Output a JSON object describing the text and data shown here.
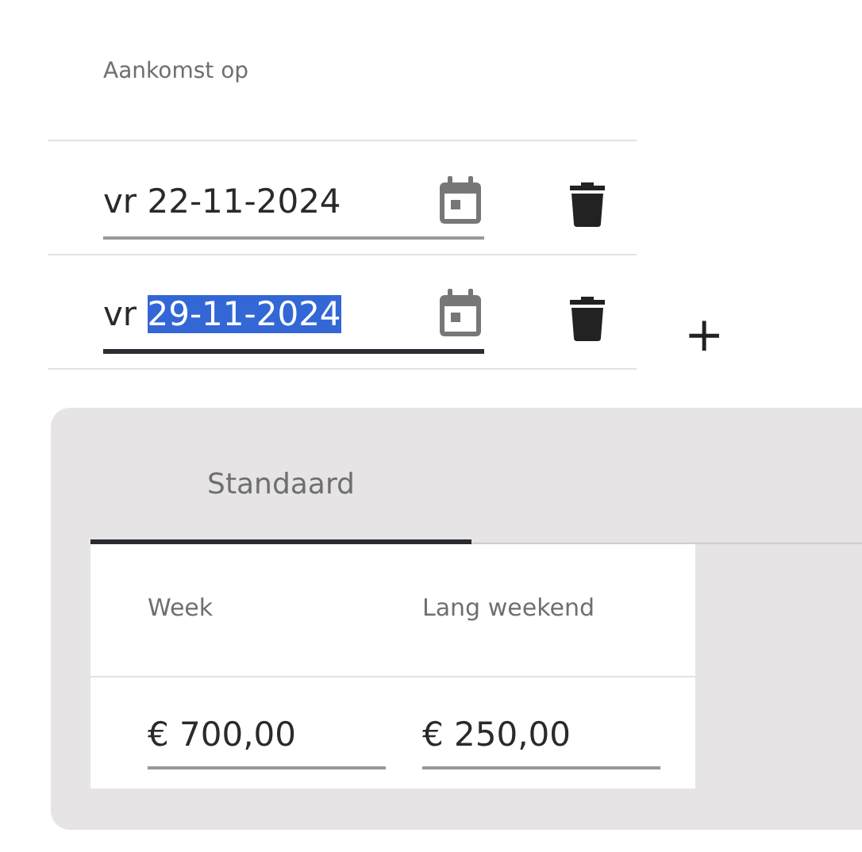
{
  "arrival": {
    "header": "Aankomst op",
    "rows": [
      {
        "weekday": "vr",
        "date": "22-11-2024",
        "focused": false,
        "text_selected": false
      },
      {
        "weekday": "vr",
        "date": "29-11-2024",
        "focused": true,
        "text_selected": true
      }
    ],
    "add_label": "+"
  },
  "prices": {
    "tabs": [
      {
        "label": "Standaard",
        "selected": true
      }
    ],
    "columns": [
      "Week",
      "Lang weekend"
    ],
    "values": [
      "€ 700,00",
      "€ 250,00"
    ]
  }
}
